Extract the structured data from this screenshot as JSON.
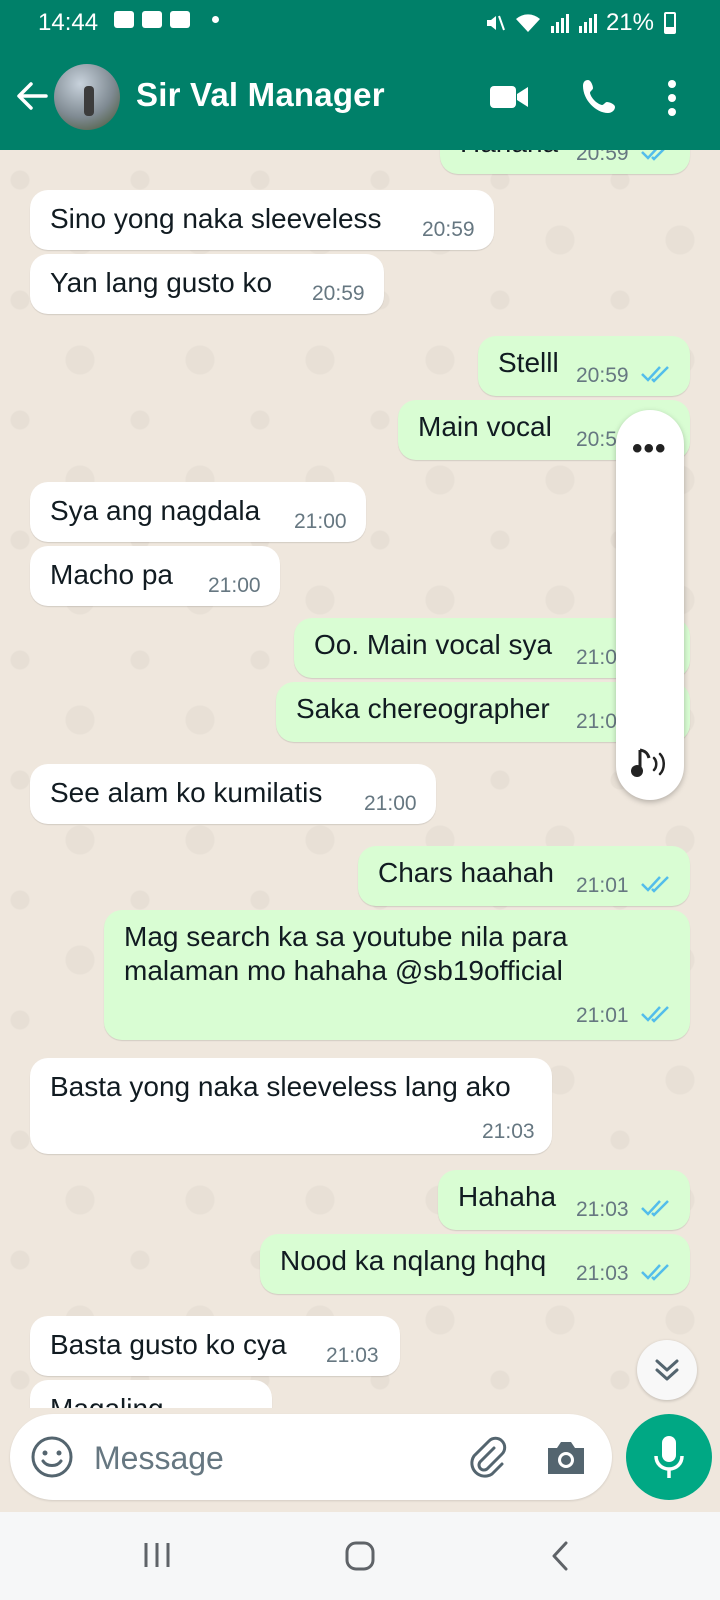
{
  "status_bar": {
    "time": "14:44",
    "battery": "21%",
    "color": "#008069"
  },
  "header": {
    "contact_name": "Sir Val Manager",
    "icons": [
      "back-arrow-icon",
      "video-call-icon",
      "voice-call-icon",
      "more-options-icon"
    ]
  },
  "messages": [
    {
      "dir": "out",
      "text": "Hahaha",
      "time": "20:59",
      "read": true
    },
    {
      "dir": "in",
      "text": "Sino yong naka sleeveless",
      "time": "20:59"
    },
    {
      "dir": "in",
      "text": "Yan lang gusto ko",
      "time": "20:59"
    },
    {
      "dir": "out",
      "text": "Stelll",
      "time": "20:59",
      "read": true
    },
    {
      "dir": "out",
      "text": "Main vocal",
      "time": "20:5",
      "read": true
    },
    {
      "dir": "in",
      "text": "Sya ang nagdala",
      "time": "21:00"
    },
    {
      "dir": "in",
      "text": "Macho pa",
      "time": "21:00"
    },
    {
      "dir": "out",
      "text": "Oo. Main vocal sya",
      "time": "21:0",
      "read": true
    },
    {
      "dir": "out",
      "text": "Saka chereographer",
      "time": "21:0",
      "read": true
    },
    {
      "dir": "in",
      "text": "See alam ko kumilatis",
      "time": "21:00"
    },
    {
      "dir": "out",
      "text": "Chars haahah",
      "time": "21:01",
      "read": true
    },
    {
      "dir": "out",
      "text": "Mag search ka sa youtube nila para malaman mo hahaha @sb19official",
      "time": "21:01",
      "read": true
    },
    {
      "dir": "in",
      "text": "Basta yong naka sleeveless lang ako",
      "time": "21:03"
    },
    {
      "dir": "out",
      "text": "Hahaha",
      "time": "21:03",
      "read": true
    },
    {
      "dir": "out",
      "text": "Nood ka nqlang hqhq",
      "time": "21:03",
      "read": true
    },
    {
      "dir": "in",
      "text": "Basta gusto ko cya",
      "time": "21:03"
    },
    {
      "dir": "in",
      "text": "Magaling",
      "time": ""
    }
  ],
  "speed_panel": {
    "dots": "•••",
    "icon": "audio-playback-icon"
  },
  "composer": {
    "placeholder": "Message",
    "icons": [
      "emoji-icon",
      "attach-icon",
      "camera-icon",
      "mic-icon"
    ],
    "accent": "#00a884"
  },
  "nav_bar": {
    "icons": [
      "recents-icon",
      "home-icon",
      "back-icon"
    ]
  },
  "colors": {
    "incoming_bubble": "#ffffff",
    "outgoing_bubble": "#d9fdd3",
    "chat_background": "#efe7dd",
    "read_tick": "#53bdeb"
  }
}
